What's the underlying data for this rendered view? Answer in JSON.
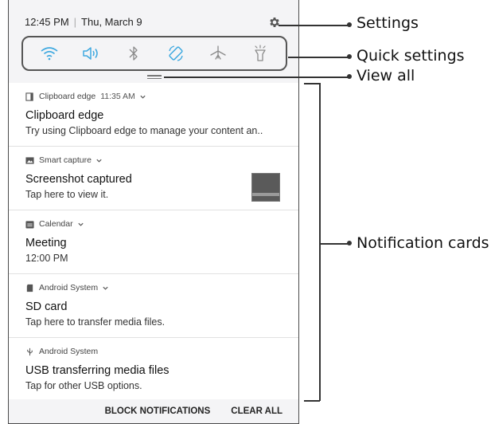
{
  "status": {
    "time": "12:45 PM",
    "separator": "|",
    "date": "Thu, March 9"
  },
  "quick_settings": [
    {
      "icon": "wifi-icon",
      "active": true
    },
    {
      "icon": "sound-icon",
      "active": true
    },
    {
      "icon": "bluetooth-icon",
      "active": false
    },
    {
      "icon": "auto-rotate-icon",
      "active": true
    },
    {
      "icon": "airplane-mode-icon",
      "active": false
    },
    {
      "icon": "flashlight-icon",
      "active": false
    }
  ],
  "notifications": [
    {
      "app": "Clipboard edge",
      "time": "11:35 AM",
      "title": "Clipboard edge",
      "body": "Try using Clipboard edge to manage your content an.."
    },
    {
      "app": "Smart capture",
      "title": "Screenshot captured",
      "body": "Tap here to view it."
    },
    {
      "app": "Calendar",
      "title": "Meeting",
      "body": "12:00 PM"
    },
    {
      "app": "Android System",
      "title": "SD card",
      "body": "Tap here to transfer media files."
    },
    {
      "app": "Android System",
      "title": "USB transferring media files",
      "body": "Tap for other USB options."
    }
  ],
  "footer": {
    "block": "BLOCK NOTIFICATIONS",
    "clear": "CLEAR ALL"
  },
  "callouts": {
    "settings": "Settings",
    "quick_settings": "Quick settings",
    "view_all": "View all",
    "notification_cards": "Notification cards"
  },
  "colors": {
    "accent": "#3fa9e0",
    "icon_gray": "#8a8a8a"
  }
}
